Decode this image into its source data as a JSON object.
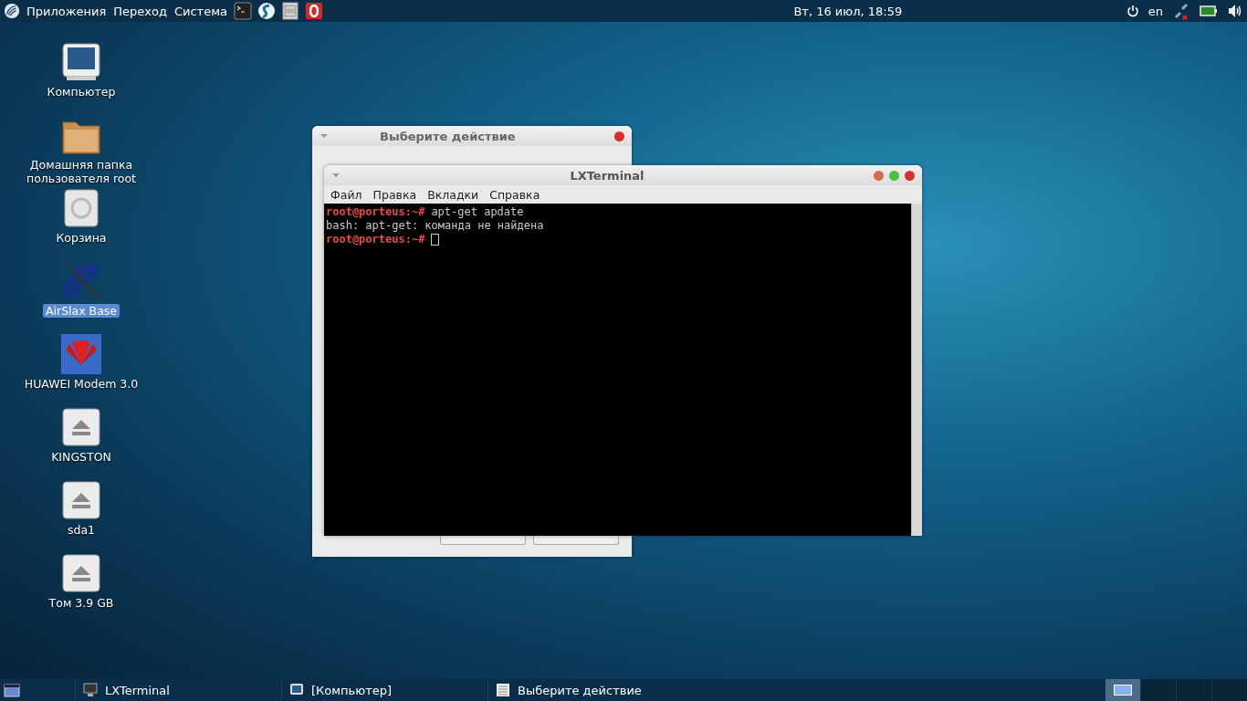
{
  "top_panel": {
    "menus": [
      "Приложения",
      "Переход",
      "Система"
    ],
    "launchers": [
      {
        "kind": "terminal"
      },
      {
        "kind": "swirl"
      },
      {
        "kind": "cabinet"
      },
      {
        "kind": "opera"
      }
    ],
    "clock": "Вт, 16 июл, 18:59",
    "keyboard_layout": "en"
  },
  "desktop_icons": [
    {
      "kind": "computer",
      "label": "Компьютер",
      "selected": false
    },
    {
      "kind": "folder",
      "label": "Домашняя папка пользователя root",
      "selected": false
    },
    {
      "kind": "trash",
      "label": "Корзина",
      "selected": false
    },
    {
      "kind": "antenna",
      "label": "AirSlax Base",
      "selected": true
    },
    {
      "kind": "modem",
      "label": "HUAWEI Modem 3.0",
      "selected": false
    },
    {
      "kind": "drive",
      "label": "KINGSTON",
      "selected": false
    },
    {
      "kind": "drive",
      "label": "sda1",
      "selected": false
    },
    {
      "kind": "drive",
      "label": "Том 3.9 GB",
      "selected": false
    }
  ],
  "dialog": {
    "title": "Выберите действие"
  },
  "terminal": {
    "title": "LXTerminal",
    "menu": [
      "Файл",
      "Правка",
      "Вкладки",
      "Справка"
    ],
    "lines": [
      {
        "kind": "prompt",
        "prompt": "root@porteus:~#",
        "command": "apt-get apdate"
      },
      {
        "kind": "output",
        "text": "bash: apt-get: команда не найдена"
      },
      {
        "kind": "prompt",
        "prompt": "root@porteus:~#",
        "cursor": true
      }
    ]
  },
  "taskbar": {
    "tasks": [
      {
        "kind": "terminal",
        "label": "LXTerminal"
      },
      {
        "kind": "computer",
        "label": "[Компьютер]"
      },
      {
        "kind": "list",
        "label": "Выберите действие"
      }
    ],
    "workspaces": [
      {
        "selected": true
      },
      {
        "selected": false
      },
      {
        "selected": false
      },
      {
        "selected": false
      }
    ]
  }
}
